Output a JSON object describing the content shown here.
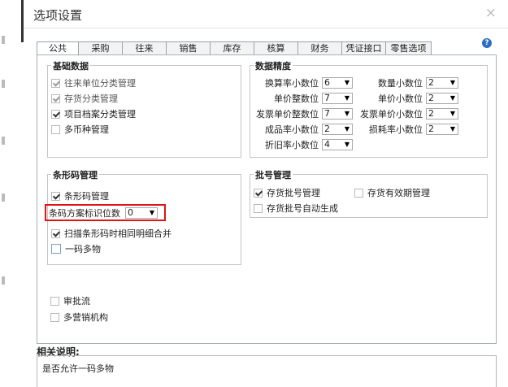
{
  "window": {
    "title": "选项设置"
  },
  "tabs": [
    "公共",
    "采购",
    "往来",
    "销售",
    "库存",
    "核算",
    "财务",
    "凭证接口",
    "零售选项"
  ],
  "groups": {
    "basic": {
      "title": "基础数据",
      "items": [
        {
          "label": "往来单位分类管理",
          "checked": true,
          "disabled": true
        },
        {
          "label": "存货分类管理",
          "checked": true,
          "disabled": true
        },
        {
          "label": "项目档案分类管理",
          "checked": true,
          "disabled": false
        },
        {
          "label": "多币种管理",
          "checked": false,
          "disabled": false
        }
      ]
    },
    "precision": {
      "title": "数据精度",
      "left": [
        {
          "label": "换算率小数位",
          "value": "6"
        },
        {
          "label": "单价整数位",
          "value": "7"
        },
        {
          "label": "发票单价整数位",
          "value": "7"
        },
        {
          "label": "成品率小数位",
          "value": "2"
        },
        {
          "label": "折旧率小数位",
          "value": "4"
        }
      ],
      "right": [
        {
          "label": "数量小数位",
          "value": "2"
        },
        {
          "label": "单价小数位",
          "value": "2"
        },
        {
          "label": "发票单价小数位",
          "value": "2"
        },
        {
          "label": "损耗率小数位",
          "value": "2"
        }
      ]
    },
    "barcode": {
      "title": "条形码管理",
      "enable_label": "条形码管理",
      "digits_label": "条码方案标识位数",
      "digits_value": "0",
      "merge_label": "扫描条形码时相同明细合并",
      "multi_label": "一码多物"
    },
    "batch": {
      "title": "批号管理",
      "batch_label": "存货批号管理",
      "expiry_label": "存货有效期管理",
      "auto_label": "存货批号自动生成"
    }
  },
  "extra": [
    {
      "label": "审批流",
      "checked": false
    },
    {
      "label": "多营销机构",
      "checked": false
    }
  ],
  "description": {
    "label": "相关说明:",
    "text": "是否允许一码多物"
  }
}
